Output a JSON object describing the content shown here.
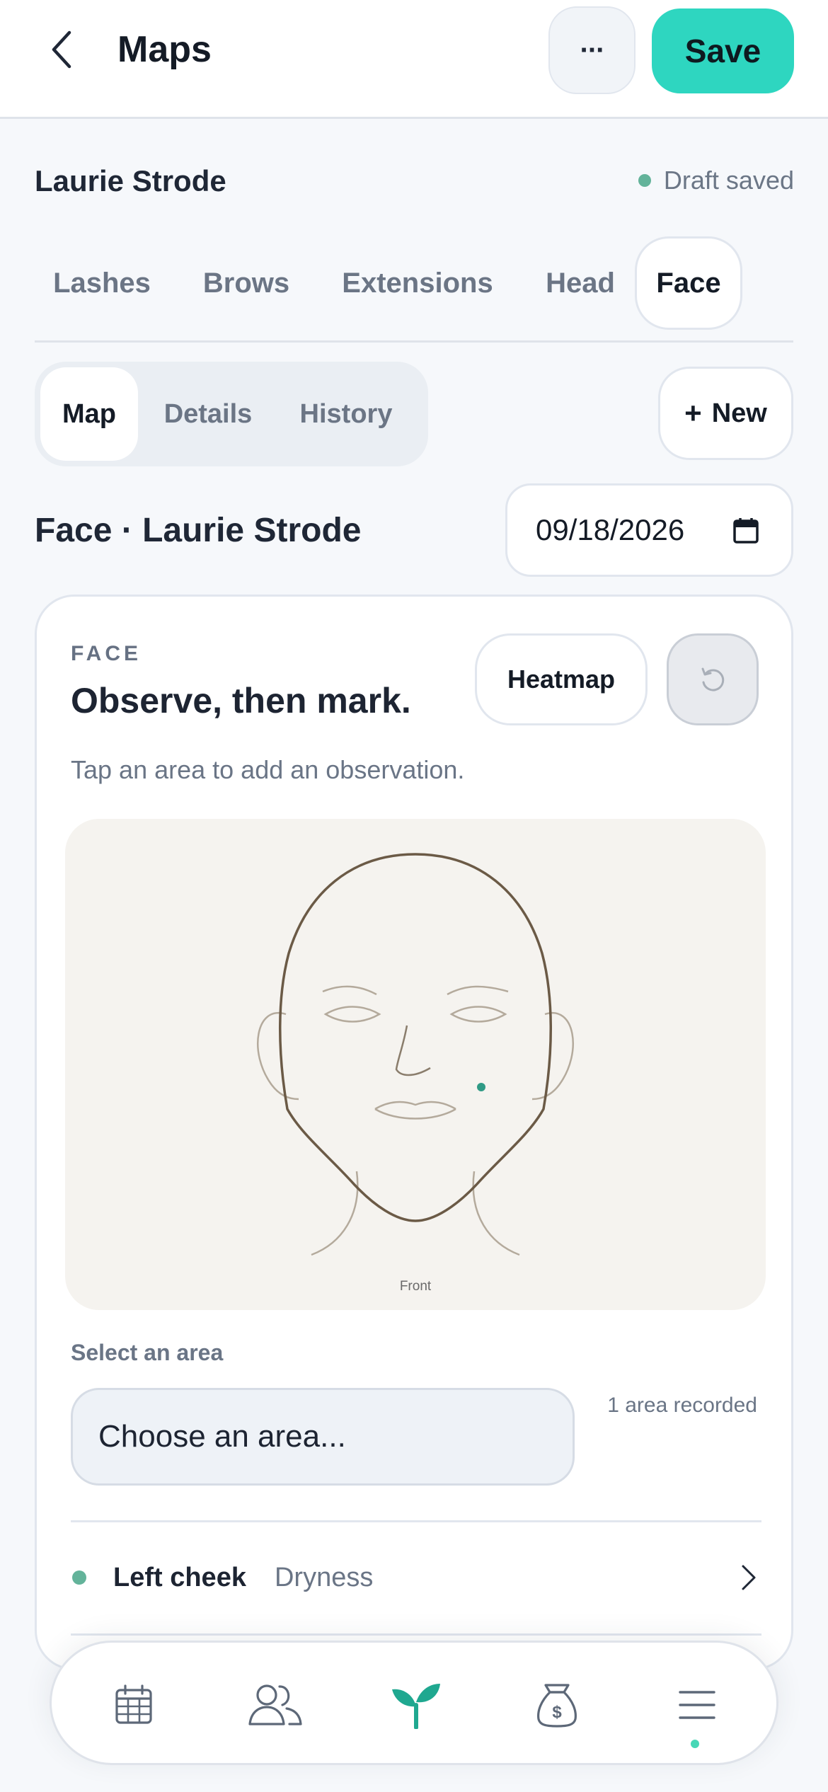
{
  "header": {
    "title": "Maps",
    "back_icon": "chevron-left-icon",
    "more_icon": "ellipsis-icon",
    "more_label": "···",
    "save_label": "Save",
    "accent_color": "#2ed6c0"
  },
  "client": {
    "name": "Laurie Strode",
    "status": "Draft saved",
    "status_color": "#63b39a"
  },
  "service_tabs": [
    {
      "label": "Lashes",
      "active": false
    },
    {
      "label": "Brows",
      "active": false
    },
    {
      "label": "Extensions",
      "active": false
    },
    {
      "label": "Head",
      "active": false
    },
    {
      "label": "Face",
      "active": true
    }
  ],
  "view_tabs": [
    {
      "label": "Map",
      "active": true
    },
    {
      "label": "Details",
      "active": false
    },
    {
      "label": "History",
      "active": false
    }
  ],
  "new_button": {
    "label": "New",
    "icon": "plus-icon",
    "glyph": "+"
  },
  "map": {
    "title": "Face · Laurie Strode",
    "date": "09/18/2026",
    "date_icon": "calendar-icon"
  },
  "card": {
    "eyebrow": "FACE",
    "heading": "Observe, then mark.",
    "heatmap_label": "Heatmap",
    "reset_icon": "undo-icon",
    "subtitle": "Tap an area to add an observation.",
    "diagram_view_label": "Front",
    "marker_color": "#2f9a85"
  },
  "area_select": {
    "label": "Select an area",
    "placeholder": "Choose an area...",
    "count_text": "1 area recorded"
  },
  "observations": [
    {
      "area": "Left cheek",
      "note": "Dryness",
      "dot_color": "#63b39a"
    }
  ],
  "bottom_nav": [
    {
      "icon": "calendar-icon",
      "active": false
    },
    {
      "icon": "clients-icon",
      "active": false
    },
    {
      "icon": "sprout-icon",
      "active": true
    },
    {
      "icon": "money-bag-icon",
      "active": false
    },
    {
      "icon": "menu-icon",
      "active": false
    }
  ]
}
